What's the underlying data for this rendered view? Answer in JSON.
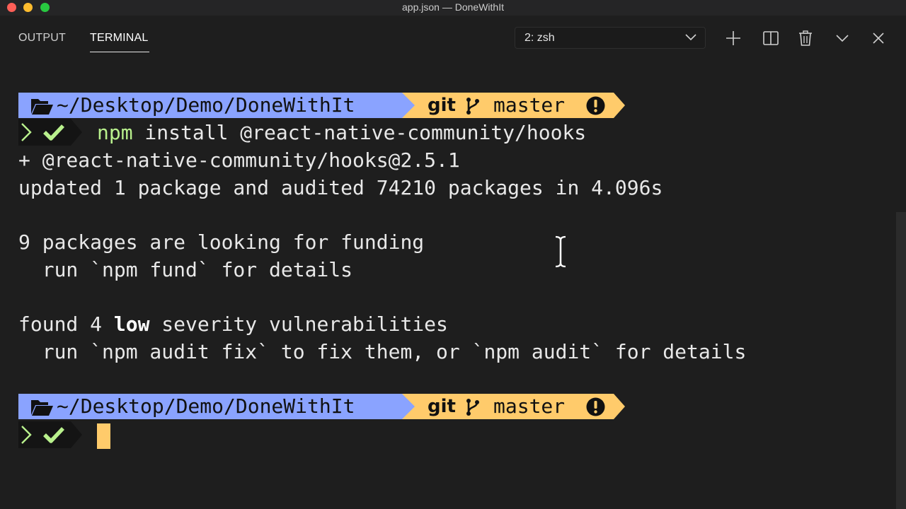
{
  "window": {
    "title": "app.json — DoneWithIt"
  },
  "panel": {
    "tabs": [
      {
        "label": "OUTPUT"
      },
      {
        "label": "TERMINAL"
      }
    ],
    "terminal_select": {
      "value": "2: zsh"
    },
    "actions": [
      "plus-icon",
      "split-icon",
      "trash-icon",
      "chevron-down-icon",
      "close-icon"
    ]
  },
  "prompt": {
    "dir": "~/Desktop/Demo/DoneWithIt",
    "git_label": "git",
    "branch": "master"
  },
  "terminal": {
    "command_prefix": "npm",
    "command_rest": " install @react-native-community/hooks",
    "output_1": "+ @react-native-community/hooks@2.5.1",
    "output_2": "updated 1 package and audited 74210 packages in 4.096s",
    "output_3": "9 packages are looking for funding",
    "output_4": "  run `npm fund` for details",
    "output_5_pre": "found 4 ",
    "output_5_bold": "low",
    "output_5_post": " severity vulnerabilities",
    "output_6": "  run `npm audit fix` to fix them, or `npm audit` for details"
  },
  "colors": {
    "dir_segment": "#8aa3ff",
    "git_segment": "#ffcb6b",
    "check": "#b9f18d",
    "cursor": "#ffcb6b"
  }
}
